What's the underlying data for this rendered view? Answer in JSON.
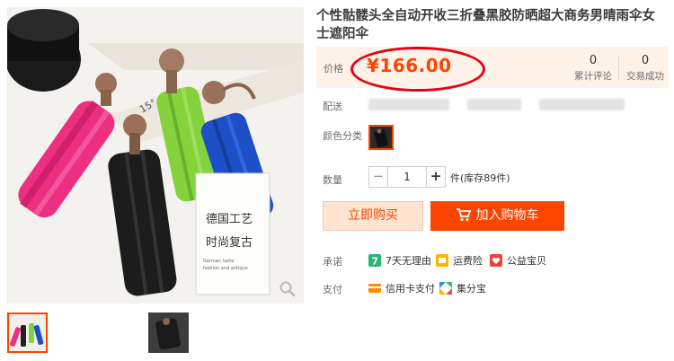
{
  "product": {
    "title": "个性骷髅头全自动开收三折叠黑胶防晒超大商务男晴雨伞女士遮阳伞"
  },
  "gallery": {
    "main_image_text_line1": "德国工艺",
    "main_image_text_line2": "时尚复古",
    "main_image_small_text_line1": "German taste",
    "main_image_small_text_line2": "fashion and antique",
    "main_image_accent": "15°"
  },
  "price": {
    "label": "价格",
    "value": "¥166.00"
  },
  "stats": {
    "reviews_count": "0",
    "reviews_label": "累计评论",
    "sales_count": "0",
    "sales_label": "交易成功"
  },
  "delivery": {
    "label": "配送"
  },
  "color": {
    "label": "颜色分类"
  },
  "quantity": {
    "label": "数量",
    "value": "1",
    "stock": "件(库存89件)"
  },
  "actions": {
    "buy_now": "立即购买",
    "add_to_cart": "加入购物车"
  },
  "promise": {
    "label": "承诺",
    "items": [
      "7天无理由",
      "运费险",
      "公益宝贝"
    ]
  },
  "payment": {
    "label": "支付",
    "items": [
      "信用卡支付",
      "集分宝"
    ]
  },
  "colors": {
    "accent": "#ff4400",
    "price": "#ff4400",
    "circle": "#e60012"
  }
}
